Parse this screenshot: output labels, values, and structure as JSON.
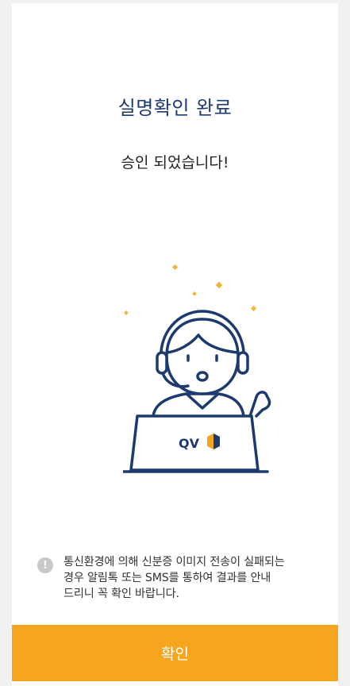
{
  "title": "실명확인 완료",
  "subtitle": "승인 되었습니다!",
  "illustration": {
    "logo_text": "QV",
    "colors": {
      "navy": "#1d3a6e",
      "accent": "#f5a51e",
      "sparkle": "#f5b335"
    }
  },
  "notice": {
    "icon": "exclamation-icon",
    "text": "통신환경에 의해 신분증 이미지 전송이 실패되는\n경우 알림톡 또는 SMS를 통하여 결과를 안내\n드리니 꼭 확인 바랍니다."
  },
  "confirm_button": {
    "label": "확인",
    "color": "#f5a51e"
  }
}
